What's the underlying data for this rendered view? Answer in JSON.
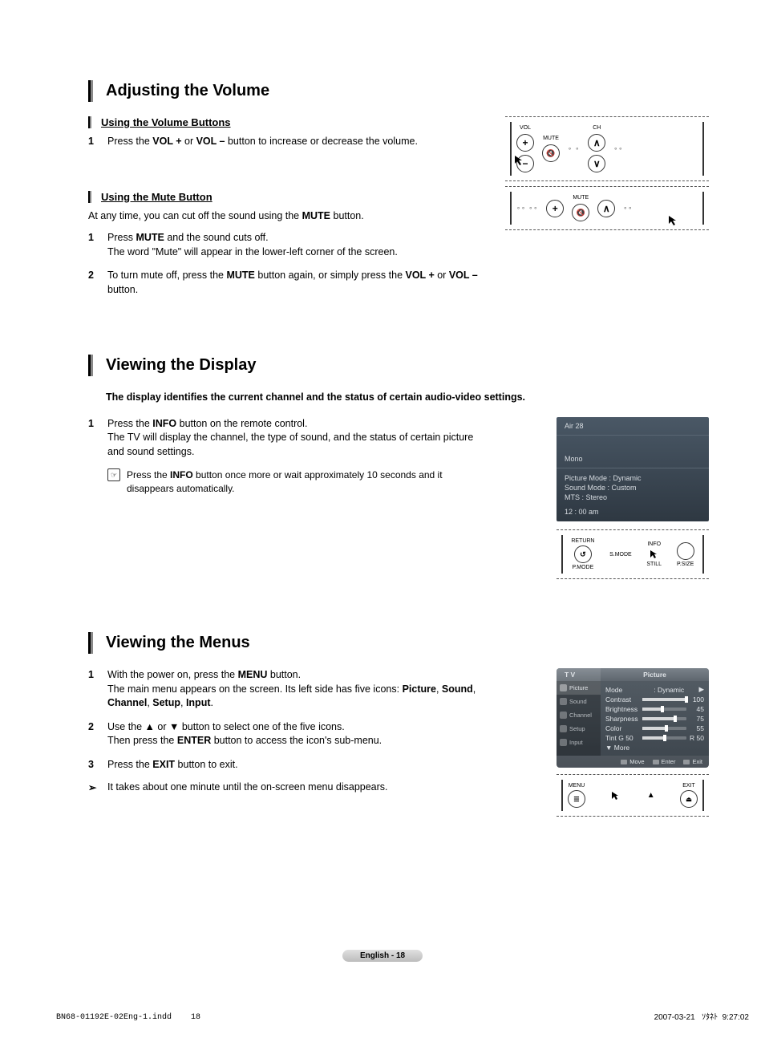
{
  "section1": {
    "title": "Adjusting the Volume",
    "sub1": {
      "title": "Using the Volume Buttons",
      "step1_num": "1",
      "step1": "Press the <b>VOL +</b> or <b>VOL –</b> button to increase or decrease the volume."
    },
    "sub2": {
      "title": "Using the Mute Button",
      "intro": "At any time, you can cut off the sound using the <b>MUTE</b> button.",
      "step1_num": "1",
      "step1": "Press <b>MUTE</b> and the sound cuts off.<br>The word \"Mute\" will appear in the lower-left corner of the screen.",
      "step2_num": "2",
      "step2": "To turn mute off, press the <b>MUTE</b> button again, or simply press the <b>VOL +</b> or <b>VOL –</b> button."
    },
    "dia": {
      "vol": "VOL",
      "ch": "CH",
      "mute": "MUTE",
      "menu": "MENU",
      "exit": "EXIT"
    }
  },
  "section2": {
    "title": "Viewing the Display",
    "intro": "The display identifies the current channel and the status of certain audio-video settings.",
    "step1_num": "1",
    "step1": "Press the <b>INFO</b> button on the remote control.<br>The TV will display the channel, the type of sound, and the status of certain picture and sound settings.",
    "note": "Press the <b>INFO</b> button once more or wait approximately 10 seconds and it disappears automatically.",
    "osd": {
      "channel": "Air 28",
      "sound": "Mono",
      "picture_mode": "Picture Mode : Dynamic",
      "sound_mode": "Sound Mode : Custom",
      "mts": "MTS : Stereo",
      "time": "12 : 00 am"
    },
    "dia": {
      "return": "RETURN",
      "info": "INFO",
      "pmode": "P.MODE",
      "smode": "S.MODE",
      "still": "STILL",
      "psize": "P.SIZE"
    }
  },
  "section3": {
    "title": "Viewing the Menus",
    "step1_num": "1",
    "step1": "With the power on, press the <b>MENU</b> button.<br>The main menu appears on the screen. Its left side has five icons: <b>Picture</b>, <b>Sound</b>, <b>Channel</b>, <b>Setup</b>, <b>Input</b>.",
    "step2_num": "2",
    "step2": "Use the ▲ or ▼ button to select one of the five icons.<br>Then press the <b>ENTER</b> button to access the icon's sub-menu.",
    "step3_num": "3",
    "step3": "Press the <b>EXIT</b> button to exit.",
    "arrow": "It takes about one minute until the on-screen menu disappears.",
    "menu": {
      "tv": "T V",
      "title": "Picture",
      "side": [
        "Picture",
        "Sound",
        "Channel",
        "Setup",
        "Input"
      ],
      "rows": [
        {
          "label": "Mode",
          "value": ": Dynamic",
          "slider": null,
          "arrow": "▶"
        },
        {
          "label": "Contrast",
          "value": "100",
          "slider": 100
        },
        {
          "label": "Brightness",
          "value": "45",
          "slider": 45
        },
        {
          "label": "Sharpness",
          "value": "75",
          "slider": 75
        },
        {
          "label": "Color",
          "value": "55",
          "slider": 55
        },
        {
          "label": "Tint",
          "left": "G 50",
          "value": "R 50",
          "slider": 50
        }
      ],
      "more": "▼ More",
      "foot": [
        "Move",
        "Enter",
        "Exit"
      ]
    },
    "dia": {
      "menu": "MENU",
      "exit": "EXIT"
    }
  },
  "footer": {
    "page": "English - 18",
    "left_file": "BN68-01192E-02Eng-1.indd",
    "left_page": "18",
    "right_date": "2007-03-21",
    "right_time": "9:27:02",
    "right_mid": "ｿﾀﾈﾄ"
  }
}
